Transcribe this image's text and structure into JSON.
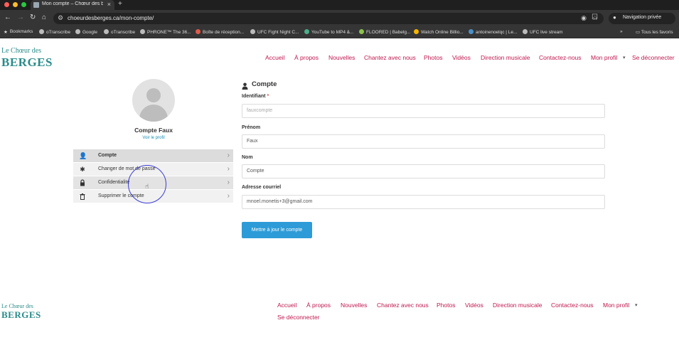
{
  "browser": {
    "tab_title": "Mon compte – Chœur des be…",
    "url": "choeurdesberges.ca/mon-compte/",
    "private_label": "Navigation privée",
    "bookmarks": [
      "Bookmarks",
      "oTranscribe",
      "Google",
      "oTranscribe",
      "PHRONE™ The 36...",
      "Boîte de réception...",
      "UFC Fight Night C...",
      "YouTube to MP4 &...",
      "FLOORED | Babelg...",
      "Watch Online Billio...",
      "antoinenoelqc | Le...",
      "UFC live stream"
    ],
    "all_bookmarks": "Tous les favoris"
  },
  "site": {
    "logo_top": "Le Chœur des",
    "logo_bottom": "BERGES",
    "nav": [
      "Accueil",
      "À propos",
      "Nouvelles",
      "Chantez avec nous",
      "Photos",
      "Vidéos",
      "Direction musicale",
      "Contactez-nous",
      "Mon profil",
      "Se déconnecter"
    ],
    "dropdown_caret": "▾"
  },
  "profile": {
    "name": "Compte Faux",
    "view_link": "Voir le profil",
    "menu": [
      {
        "label": "Compte",
        "icon": "user-icon",
        "active": true
      },
      {
        "label": "Changer de mot de passe",
        "icon": "asterisk-icon",
        "active": false
      },
      {
        "label": "Confidentialité",
        "icon": "lock-icon",
        "active": false
      },
      {
        "label": "Supprimer le compte",
        "icon": "trash-icon",
        "active": false
      }
    ]
  },
  "form": {
    "title": "Compte",
    "fields": [
      {
        "label": "Identifiant",
        "required": "*",
        "value": "fauxcompte"
      },
      {
        "label": "Prénom",
        "value": "Faux"
      },
      {
        "label": "Nom",
        "value": "Compte"
      },
      {
        "label": "Adresse courriel",
        "value": "mnoel.monetis+3@gmail.com"
      }
    ],
    "submit_label": "Mettre à jour le compte"
  },
  "footer": {
    "nav_row1": [
      "Accueil",
      "À propos",
      "Nouvelles",
      "Chantez avec nous",
      "Photos",
      "Vidéos",
      "Direction musicale",
      "Contactez-nous",
      "Mon profil"
    ],
    "nav_row2": [
      "Se déconnecter"
    ]
  },
  "colors": {
    "accent": "#c0184e",
    "brand": "#2a8c8a",
    "button": "#2d9bd7"
  }
}
